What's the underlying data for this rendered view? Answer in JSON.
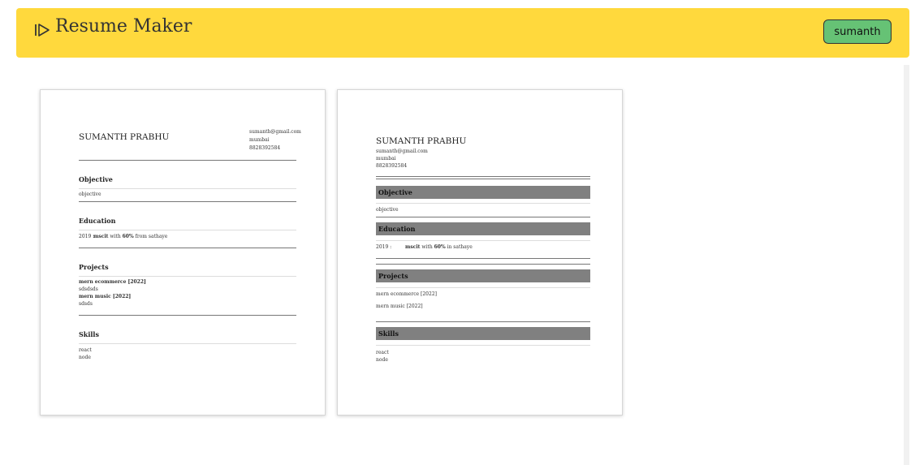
{
  "app": {
    "title": "Resume Maker"
  },
  "header": {
    "user_label": "sumanth",
    "accent": "#ffd93d",
    "user_btn_color": "#66c275"
  },
  "resumes": [
    {
      "name": "SUMANTH PRABHU",
      "email": "sumanth@gmail.com",
      "city": "mumbai",
      "phone": "8828392584",
      "objective_heading": "Objective",
      "objective": "objective",
      "education_heading": "Education",
      "edu_year": "2019 :",
      "edu_degree": "mscit",
      "edu_with": "with",
      "edu_score": "60%",
      "edu_from": "from sathaye",
      "projects_heading": "Projects",
      "project1_title": "mern ecommerce [2022]",
      "project1_desc": "sdsdsds",
      "project2_title": "mern music [2022]",
      "project2_desc": "sdsds",
      "skills_heading": "Skills",
      "skill1": "react",
      "skill2": "node"
    },
    {
      "name": "SUMANTH PRABHU",
      "email": "sumanth@gmail.com",
      "city": "mumbai",
      "phone": "8828392584",
      "objective_heading": "Objective",
      "objective": "objective",
      "education_heading": "Education",
      "edu_year": "2019 :",
      "edu_degree": "mscit",
      "edu_with": "with",
      "edu_score": "60%",
      "edu_in": "in sathaye",
      "projects_heading": "Projects",
      "project1_title": "mern ecommerce [2022]",
      "project2_title": "mern music [2022]",
      "skills_heading": "Skills",
      "skill1": "react",
      "skill2": "node"
    }
  ]
}
